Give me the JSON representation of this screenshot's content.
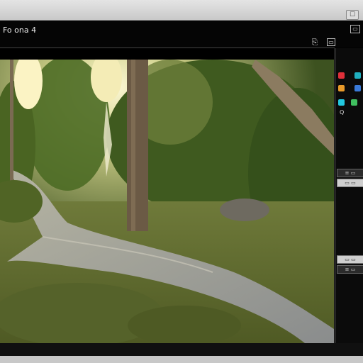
{
  "window": {
    "title": "",
    "close_label": "☐"
  },
  "toolbar": {
    "app_label": "Fo ona 4",
    "button_a": "⎘",
    "button_b": "▭",
    "button_c": "▭"
  },
  "panel": {
    "swatches": [
      {
        "name": "red",
        "color": "#e0303a"
      },
      {
        "name": "teal",
        "color": "#20b0c0"
      },
      {
        "name": "orange",
        "color": "#e89a2a"
      },
      {
        "name": "blue",
        "color": "#3a7ad8"
      },
      {
        "name": "cyan",
        "color": "#22c8e0"
      },
      {
        "name": "green",
        "color": "#40c060"
      }
    ],
    "row_text": "Q",
    "bar_1": "≡ ▭",
    "bar_2": "▭ ▭",
    "bar_3": "▭ ▭",
    "bar_4": "≡ ▭"
  },
  "scene": {
    "description_colors": {
      "sky": "#f6efc0",
      "foliage": "#4e6a28",
      "path": "#9a9a94"
    }
  }
}
